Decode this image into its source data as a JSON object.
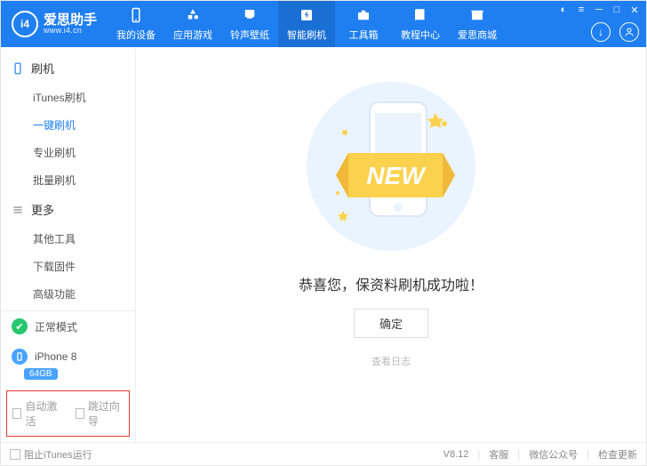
{
  "app": {
    "name": "爱思助手",
    "url": "www.i4.cn",
    "logo_text": "i4"
  },
  "header": {
    "navs": [
      {
        "label": "我的设备"
      },
      {
        "label": "应用游戏"
      },
      {
        "label": "铃声壁纸"
      },
      {
        "label": "智能刷机",
        "active": true
      },
      {
        "label": "工具箱"
      },
      {
        "label": "教程中心"
      },
      {
        "label": "爱思商城"
      }
    ]
  },
  "sidebar": {
    "group1": {
      "title": "刷机",
      "items": [
        {
          "label": "iTunes刷机"
        },
        {
          "label": "一键刷机",
          "active": true
        },
        {
          "label": "专业刷机"
        },
        {
          "label": "批量刷机"
        }
      ]
    },
    "group2": {
      "title": "更多",
      "items": [
        {
          "label": "其他工具"
        },
        {
          "label": "下载固件"
        },
        {
          "label": "高级功能"
        }
      ]
    },
    "mode": "正常模式",
    "device": {
      "name": "iPhone 8",
      "storage": "64GB"
    },
    "opt1": "自动激活",
    "opt2": "跳过向导"
  },
  "main": {
    "banner": "NEW",
    "message": "恭喜您，保资料刷机成功啦！",
    "ok": "确定",
    "log": "查看日志"
  },
  "footer": {
    "block_itunes": "阻止iTunes运行",
    "version": "V8.12",
    "svc": "客服",
    "wx": "微信公众号",
    "upd": "检查更新"
  },
  "colors": {
    "primary": "#207ff0"
  }
}
